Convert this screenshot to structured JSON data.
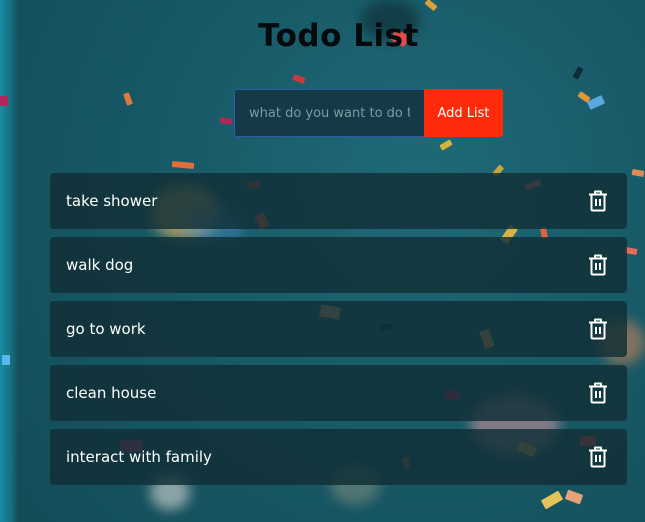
{
  "app": {
    "title": "Todo List"
  },
  "form": {
    "placeholder": "what do you want to do to",
    "value": "",
    "button_label": "Add List"
  },
  "todos": [
    {
      "label": "take shower",
      "icon": "trash-icon"
    },
    {
      "label": "walk dog",
      "icon": "trash-icon"
    },
    {
      "label": "go to work",
      "icon": "trash-icon"
    },
    {
      "label": "clean house",
      "icon": "trash-icon"
    },
    {
      "label": "interact with family",
      "icon": "trash-icon"
    }
  ],
  "colors": {
    "accent": "#ff2a0a",
    "background": "#185a67",
    "item_background": "#112e36",
    "input_border": "#2f5aa8",
    "title": "#050a0c"
  }
}
